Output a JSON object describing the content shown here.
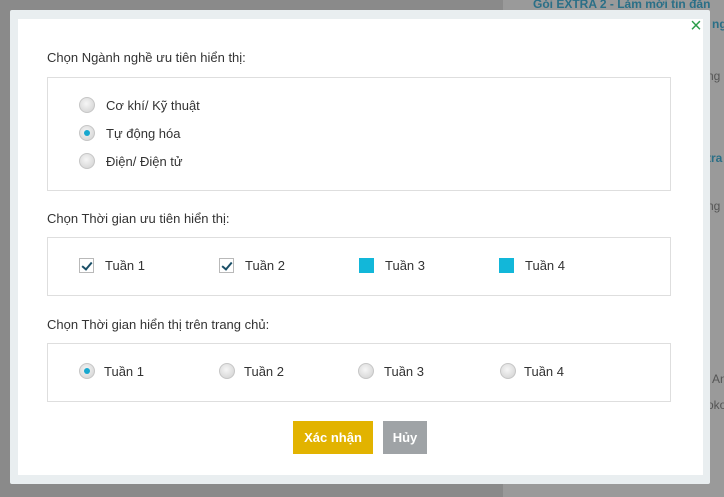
{
  "background": {
    "link_text": "Gói EXTRA 2 - Làm mới tin đăn",
    "link_frag": "ng",
    "frags": [
      "ng",
      "tra",
      "ng",
      "An",
      "oko"
    ]
  },
  "modal": {
    "close_icon": "×",
    "section1": {
      "title": "Chọn Ngành nghề ưu tiên hiển thị:",
      "options": [
        "Cơ khí/ Kỹ thuật",
        "Tự động hóa",
        "Điện/ Điện tử"
      ],
      "selected": "Tự động hóa"
    },
    "section2": {
      "title": "Chọn Thời gian ưu tiên hiển thị:",
      "options": [
        "Tuần 1",
        "Tuần 2",
        "Tuần 3",
        "Tuần 4"
      ],
      "checked": [
        "Tuần 1",
        "Tuần 2"
      ]
    },
    "section3": {
      "title": "Chọn Thời gian hiển thị trên trang chủ:",
      "options": [
        "Tuần 1",
        "Tuần 2",
        "Tuần 3",
        "Tuần 4"
      ],
      "selected": "Tuần 1"
    },
    "buttons": {
      "confirm": "Xác nhận",
      "cancel": "Hủy"
    },
    "colors": {
      "accent": "#17a8cf",
      "confirm": "#e2b300",
      "cancel": "#9fa3a6",
      "close": "#2b9d4a"
    }
  }
}
